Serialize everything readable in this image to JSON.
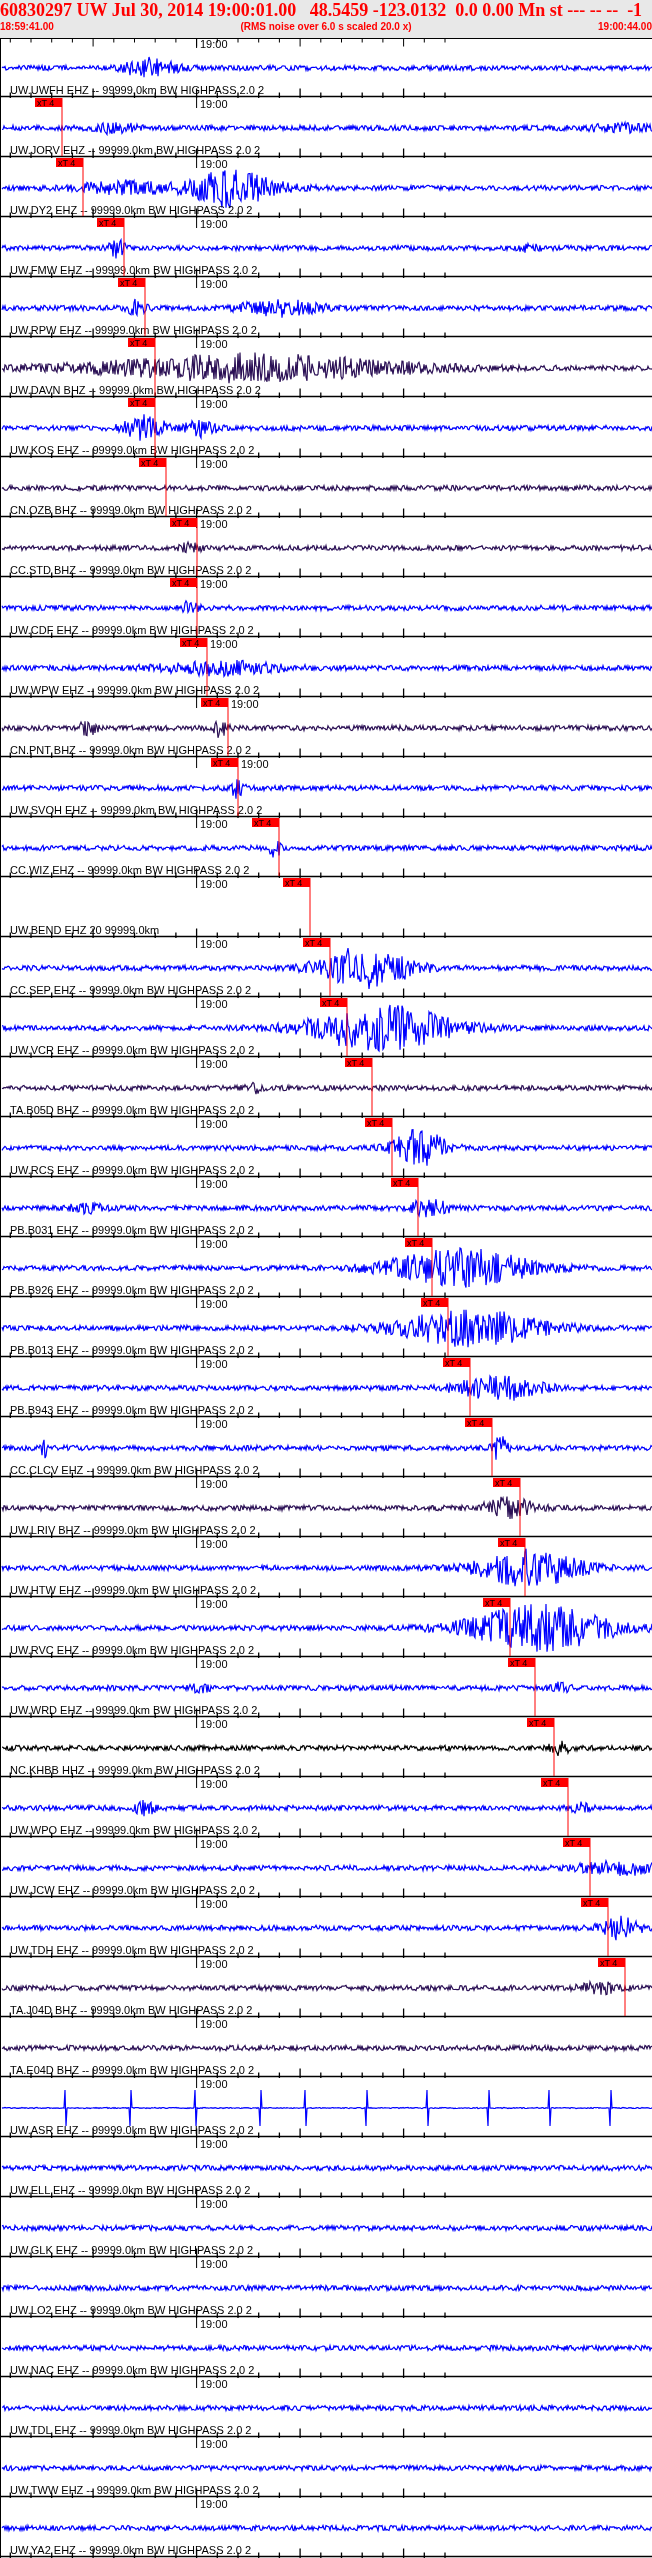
{
  "header": {
    "title": "60830297 UW Jul 30, 2014 19:00:01.00   48.5459 -123.0132  0.0 0.00 Mn st --- -- --  -1",
    "start_time": "18:59:41.00",
    "note": "(RMS noise over 6.0 s scaled 20.0 x)",
    "end_time": "19:00:44.00"
  },
  "traces": [
    {
      "label": "UW.UWFH EHZ -- 99999.0km BW HIGHPASS 2.0 2",
      "time_mark": "19:00",
      "color": "#0000ff"
    },
    {
      "label": "UW.JORV EHZ -- 99999.0km BW HIGHPASS 2.0 2",
      "time_mark": "19:00",
      "color": "#0000ff",
      "pick": "xT 4"
    },
    {
      "label": "UW.DY2 EHZ -- 99999.0km BW HIGHPASS 2.0 2",
      "time_mark": "19:00",
      "color": "#0000ff",
      "pick": "xT 4"
    },
    {
      "label": "UW.FMW EHZ -- 99999.0km BW HIGHPASS 2.0 2",
      "time_mark": "19:00",
      "color": "#0000ff",
      "pick": "xT 4"
    },
    {
      "label": "UW.RPW EHZ -- 99999.0km BW HIGHPASS 2.0 2",
      "time_mark": "19:00",
      "color": "#0000ff",
      "pick": "xT 4"
    },
    {
      "label": "UW.DAVN BHZ -- 99999.0km BW HIGHPASS 2.0 2",
      "time_mark": "19:00",
      "color": "#2b1055",
      "pick": "xT 4"
    },
    {
      "label": "UW.KOS EHZ -- 99999.0km BW HIGHPASS 2.0 2",
      "time_mark": "19:00",
      "color": "#0000ff",
      "pick": "xT 4"
    },
    {
      "label": "CN.OZB BHZ -- 99999.0km BW HIGHPASS 2.0 2",
      "time_mark": "19:00",
      "color": "#2b1055",
      "pick": "xT 4"
    },
    {
      "label": "CC.STD BHZ -- 99999.0km BW HIGHPASS 2.0 2",
      "time_mark": "19:00",
      "color": "#2b1055",
      "pick": "xT 4"
    },
    {
      "label": "UW.CDF EHZ -- 99999.0km BW HIGHPASS 2.0 2",
      "time_mark": "19:00",
      "color": "#0000ff",
      "pick": "xT 4"
    },
    {
      "label": "UW.WPW EHZ -- 99999.0km BW HIGHPASS 2.0 2",
      "time_mark": "19:00",
      "color": "#0000ff",
      "pick": "xT 4"
    },
    {
      "label": "CN.PNT BHZ -- 99999.0km BW HIGHPASS 2.0 2",
      "time_mark": "19:00",
      "color": "#2b1055",
      "pick": "xT 4"
    },
    {
      "label": "UW.SVOH EHZ -- 99999.0km BW HIGHPASS 2.0 2",
      "time_mark": "19:00",
      "color": "#0000ff",
      "pick": "xT 4"
    },
    {
      "label": "CC.WIZ EHZ -- 99999.0km BW HIGHPASS 2.0 2",
      "time_mark": "19:00",
      "color": "#0000ff",
      "pick": "xT 4"
    },
    {
      "label": "UW.BEND EHZ 20 99999.0km",
      "time_mark": "19:00",
      "pick": "xT 4"
    },
    {
      "label": "CC.SEP EHZ -- 99999.0km BW HIGHPASS 2.0 2",
      "time_mark": "19:00",
      "color": "#0000ff",
      "pick": "xT 4"
    },
    {
      "label": "UW.VCR EHZ -- 99999.0km BW HIGHPASS 2.0 2",
      "time_mark": "19:00",
      "color": "#0000ff",
      "pick": "xT 4"
    },
    {
      "label": "TA.B05D BHZ -- 99999.0km BW HIGHPASS 2.0 2",
      "time_mark": "19:00",
      "color": "#2b1055",
      "pick": "xT 4"
    },
    {
      "label": "UW.RCS EHZ -- 99999.0km BW HIGHPASS 2.0 2",
      "time_mark": "19:00",
      "color": "#0000ff",
      "pick": "xT 4"
    },
    {
      "label": "PB.B031 EHZ -- 99999.0km BW HIGHPASS 2.0 2",
      "time_mark": "19:00",
      "color": "#0000ff",
      "pick": "xT 4"
    },
    {
      "label": "PB.B926 EHZ -- 99999.0km BW HIGHPASS 2.0 2",
      "time_mark": "19:00",
      "color": "#0000ff",
      "pick": "xT 4"
    },
    {
      "label": "PB.B013 EHZ -- 99999.0km BW HIGHPASS 2.0 2",
      "time_mark": "19:00",
      "color": "#0000ff",
      "pick": "xT 4"
    },
    {
      "label": "PB.B943 EHZ -- 99999.0km BW HIGHPASS 2.0 2",
      "time_mark": "19:00",
      "color": "#0000ff",
      "pick": "xT 4"
    },
    {
      "label": "CC.CLCV EHZ -- 99999.0km BW HIGHPASS 2.0 2",
      "time_mark": "19:00",
      "color": "#0000ff",
      "pick": "xT 4"
    },
    {
      "label": "UW.LRIV BHZ -- 99999.0km BW HIGHPASS 2.0 2",
      "time_mark": "19:00",
      "color": "#2b1055",
      "pick": "xT 4"
    },
    {
      "label": "UW.HTW EHZ -- 99999.0km BW HIGHPASS 2.0 2",
      "time_mark": "19:00",
      "color": "#0000ff",
      "pick": "xT 4"
    },
    {
      "label": "UW.RVC EHZ -- 99999.0km BW HIGHPASS 2.0 2",
      "time_mark": "19:00",
      "color": "#0000ff",
      "pick": "xT 4"
    },
    {
      "label": "UW.WRD EHZ -- 99999.0km BW HIGHPASS 2.0 2",
      "time_mark": "19:00",
      "color": "#0000ff",
      "pick": "xT 4"
    },
    {
      "label": "NC.KHBB HHZ -- 99999.0km BW HIGHPASS 2.0 2",
      "time_mark": "19:00",
      "color": "#000000",
      "pick": "xT 4"
    },
    {
      "label": "UW.WPO EHZ -- 99999.0km BW HIGHPASS 2.0 2",
      "time_mark": "19:00",
      "color": "#0000ff",
      "pick": "xT 4"
    },
    {
      "label": "UW.JCW EHZ -- 99999.0km BW HIGHPASS 2.0 2",
      "time_mark": "19:00",
      "color": "#0000ff",
      "pick": "xT 4"
    },
    {
      "label": "UW.TDH EHZ -- 99999.0km BW HIGHPASS 2.0 2",
      "time_mark": "19:00",
      "color": "#0000ff",
      "pick": "xT 4"
    },
    {
      "label": "TA.J04D BHZ -- 99999.0km BW HIGHPASS 2.0 2",
      "time_mark": "19:00",
      "color": "#2b1055",
      "pick": "xT 4"
    },
    {
      "label": "TA.E04D BHZ -- 99999.0km BW HIGHPASS 2.0 2",
      "time_mark": "19:00",
      "color": "#2b1055"
    },
    {
      "label": "UW.ASR EHZ -- 99999.0km BW HIGHPASS 2.0 2",
      "time_mark": "19:00",
      "color": "#0000ff"
    },
    {
      "label": "UW.ELL EHZ -- 99999.0km BW HIGHPASS 2.0 2",
      "time_mark": "19:00",
      "color": "#0000ff"
    },
    {
      "label": "UW.GLK EHZ -- 99999.0km BW HIGHPASS 2.0 2",
      "time_mark": "19:00",
      "color": "#0000ff"
    },
    {
      "label": "UW.LO2 EHZ -- 99999.0km BW HIGHPASS 2.0 2",
      "time_mark": "19:00",
      "color": "#0000ff"
    },
    {
      "label": "UW.NAC EHZ -- 99999.0km BW HIGHPASS 2.0 2",
      "time_mark": "19:00",
      "color": "#0000ff"
    },
    {
      "label": "UW.TDL EHZ -- 99999.0km BW HIGHPASS 2.0 2",
      "time_mark": "19:00",
      "color": "#0000ff"
    },
    {
      "label": "UW.TWW EHZ -- 99999.0km BW HIGHPASS 2.0 2",
      "time_mark": "19:00",
      "color": "#0000ff"
    },
    {
      "label": "UW.YA2 EHZ -- 99999.0km BW HIGHPASS 2.0 2",
      "time_mark": "19:00",
      "color": "#0000ff"
    }
  ]
}
